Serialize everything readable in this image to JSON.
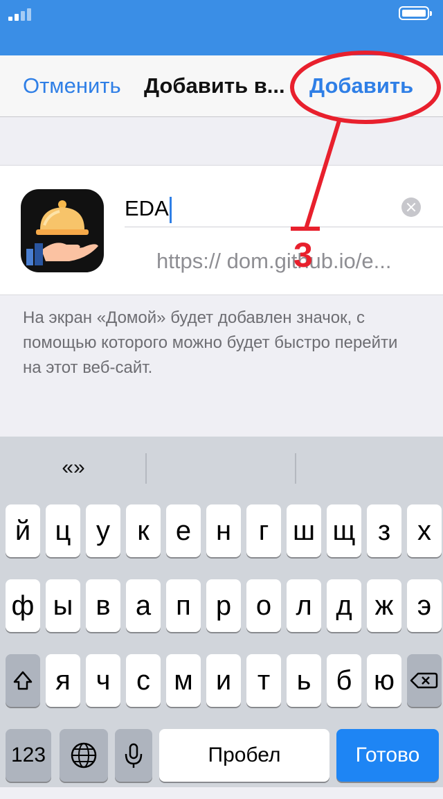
{
  "nav": {
    "cancel": "Отменить",
    "title": "Добавить в...",
    "add": "Добавить"
  },
  "site": {
    "name_value": "EDA",
    "url": "https:// dom.github.io/e..."
  },
  "info": "На экран «Домой» будет добавлен значок, с помощью которого можно будет быстро перейти на этот веб-сайт.",
  "annotation": {
    "label": "3",
    "color": "#e8202d"
  },
  "keyboard": {
    "suggestions": [
      "«»",
      "",
      ""
    ],
    "row1": [
      "й",
      "ц",
      "у",
      "к",
      "е",
      "н",
      "г",
      "ш",
      "щ",
      "з",
      "х"
    ],
    "row2": [
      "ф",
      "ы",
      "в",
      "а",
      "п",
      "р",
      "о",
      "л",
      "д",
      "ж",
      "э"
    ],
    "row3": [
      "я",
      "ч",
      "с",
      "м",
      "и",
      "т",
      "ь",
      "б",
      "ю"
    ],
    "numbers_key": "123",
    "space_key": "Пробел",
    "done_key": "Готово"
  },
  "colors": {
    "accent": "#2f7fe6",
    "status_bar": "#3a8ee6",
    "done_key": "#1e85f4"
  }
}
